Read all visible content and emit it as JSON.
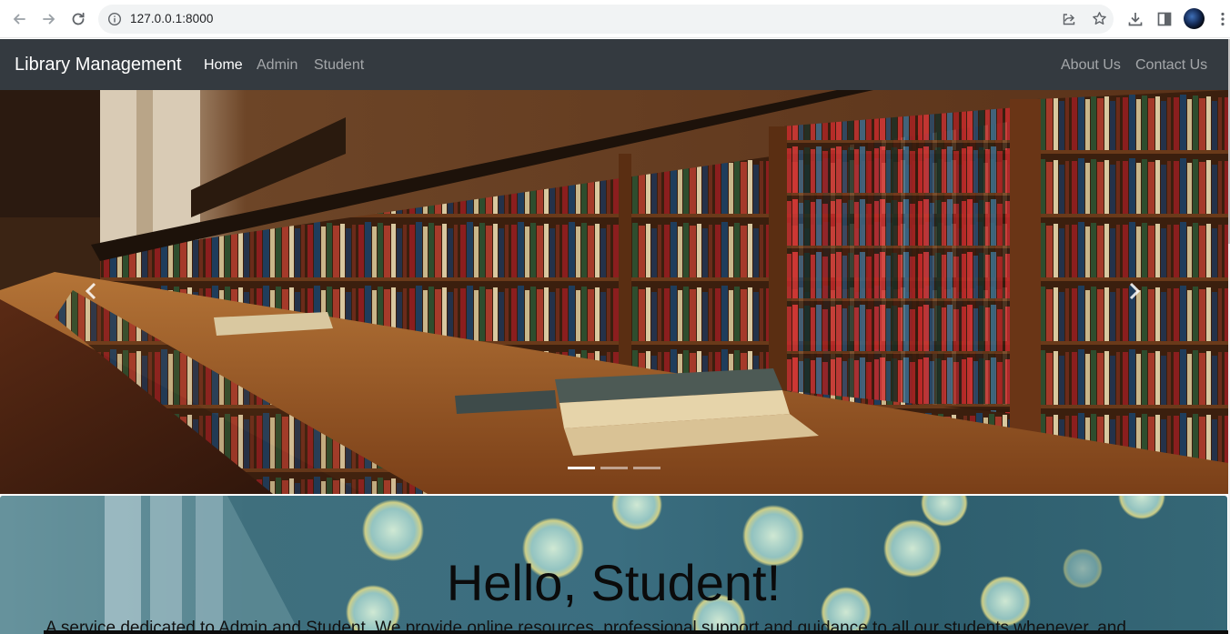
{
  "browser": {
    "url": "127.0.0.1:8000",
    "icons": [
      "back-icon",
      "forward-icon",
      "reload-icon",
      "site-info-icon",
      "share-icon",
      "bookmark-star-icon",
      "download-icon",
      "side-panel-icon",
      "profile-avatar",
      "menu-kebab-icon"
    ]
  },
  "navbar": {
    "brand": "Library Management",
    "links": [
      {
        "label": "Home",
        "active": true
      },
      {
        "label": "Admin",
        "active": false
      },
      {
        "label": "Student",
        "active": false
      }
    ],
    "right_links": [
      {
        "label": "About Us"
      },
      {
        "label": "Contact Us"
      }
    ],
    "background": "#343a40"
  },
  "carousel": {
    "image_description": "library reading room with wooden bookshelves and stacked books on a long table",
    "indicators": 3,
    "active_indicator": 1
  },
  "jumbotron": {
    "heading": "Hello, Student!",
    "text": "A service dedicated to Admin and Student. We provide online resources, professional support and guidance to all our students whenever, and"
  }
}
